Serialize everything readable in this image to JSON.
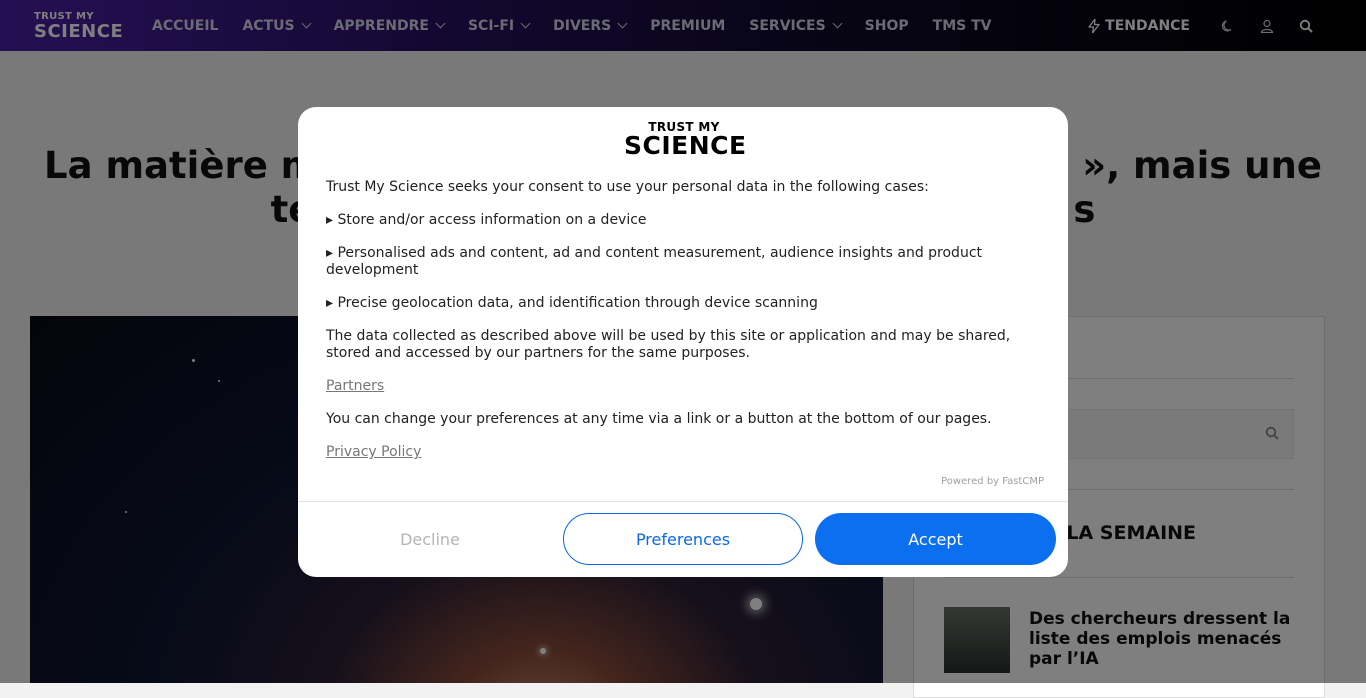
{
  "nav": {
    "logo": {
      "line1": "TRUST MY",
      "line2": "SCIENCE"
    },
    "items": [
      {
        "label": "ACCUEIL",
        "dropdown": false
      },
      {
        "label": "ACTUS",
        "dropdown": true
      },
      {
        "label": "APPRENDRE",
        "dropdown": true
      },
      {
        "label": "SCI-FI",
        "dropdown": true
      },
      {
        "label": "DIVERS",
        "dropdown": true
      },
      {
        "label": "PREMIUM",
        "dropdown": false
      },
      {
        "label": "SERVICES",
        "dropdown": true
      },
      {
        "label": "SHOP",
        "dropdown": false
      },
      {
        "label": "TMS TV",
        "dropdown": false
      }
    ],
    "trending_label": "TENDANCE",
    "icons": [
      "bolt-icon",
      "moon-icon",
      "user-icon",
      "search-icon"
    ]
  },
  "article": {
    "headline_visible_left": "La matière m",
    "headline_visible_right": "e », mais une",
    "headline_line2_left": "te",
    "headline_line2_right": "s"
  },
  "sidebar": {
    "heading_partial": "DE LA SEMAINE",
    "article_title": "Des chercheurs dressent la liste des emplois menacés par l’IA"
  },
  "consent": {
    "logo": {
      "line1": "TRUST MY",
      "line2": "SCIENCE"
    },
    "intro": "Trust My Science seeks your consent to use your personal data in the following cases:",
    "purposes": [
      "▸ Store and/or access information on a device",
      "▸ Personalised ads and content, ad and content measurement, audience insights and product development",
      "▸ Precise geolocation data, and identification through device scanning"
    ],
    "sharing_text": "The data collected as described above will be used by this site or application and may be shared, stored and accessed by our partners for the same purposes.",
    "partners_link": "Partners",
    "change_text": "You can change your preferences at any time via a link or a button at the bottom of our pages.",
    "privacy_link": "Privacy Policy",
    "powered_by": "Powered by FastCMP",
    "buttons": {
      "decline": "Decline",
      "preferences": "Preferences",
      "accept": "Accept"
    },
    "colors": {
      "accent": "#0b6ff0",
      "decline_text": "#b4b4b4"
    }
  }
}
